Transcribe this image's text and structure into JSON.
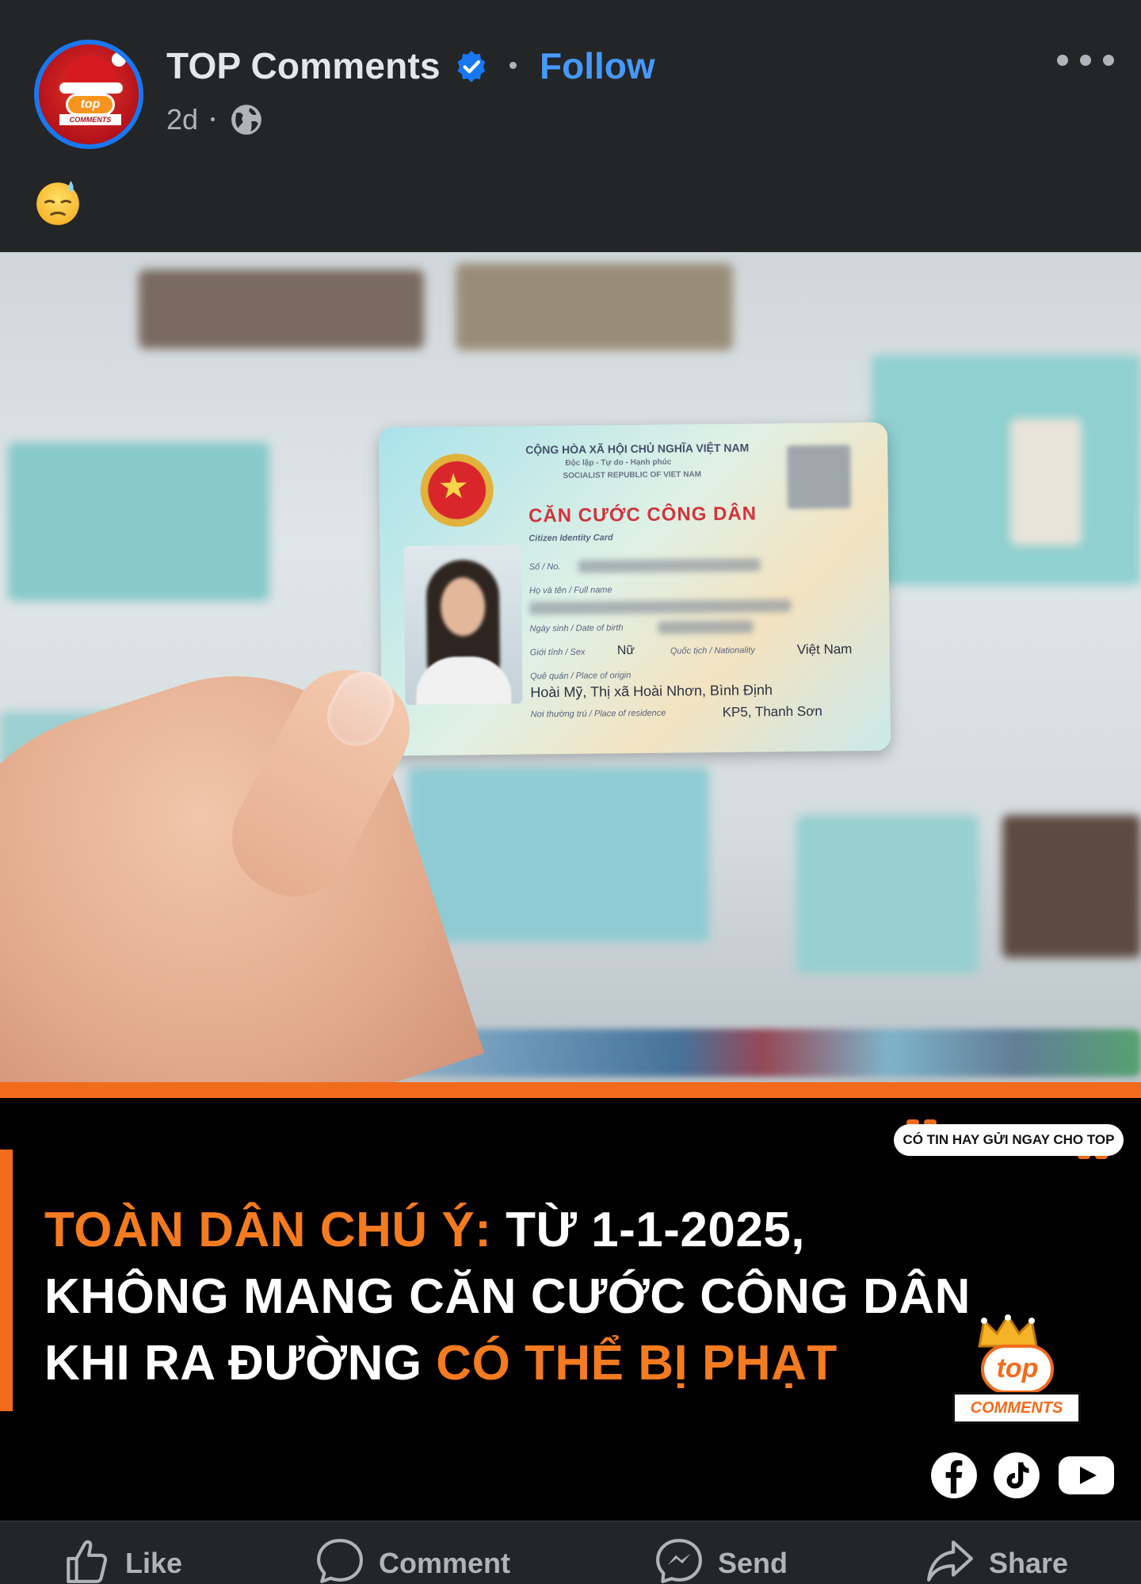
{
  "post": {
    "page_name": "TOP Comments",
    "follow_label": "Follow",
    "time": "2d",
    "emoji": "😓"
  },
  "id_card": {
    "header_line1": "CỘNG HÒA XÃ HỘI CHỦ NGHĨA VIỆT NAM",
    "header_line2": "Độc lập - Tự do - Hạnh phúc",
    "header_line3": "SOCIALIST REPUBLIC OF VIET NAM",
    "title": "CĂN CƯỚC CÔNG DÂN",
    "subtitle": "Citizen Identity Card",
    "label_no": "Số / No.",
    "label_name": "Họ và tên / Full name",
    "label_dob": "Ngày sinh / Date of birth",
    "label_sex": "Giới tính / Sex",
    "sex_value": "Nữ",
    "label_nationality": "Quốc tịch / Nationality",
    "nationality_value": "Việt Nam",
    "label_origin": "Quê quán / Place of origin",
    "origin_value": "Hoài Mỹ, Thị xã Hoài Nhơn, Bình Định",
    "label_residence": "Nơi thường trú / Place of residence",
    "residence_value": "KP5, Thanh Sơn"
  },
  "banner": {
    "tip_text": "CÓ TIN HAY GỬI NGAY CHO TOP",
    "headline_orange_1": "TOÀN DÂN CHÚ Ý:",
    "headline_white_1": " TỪ 1-1-2025,",
    "headline_white_2": "KHÔNG MANG CĂN CƯỚC CÔNG DÂN",
    "headline_white_3": "KHI RA ĐƯỜNG ",
    "headline_orange_3": "CÓ THỂ BỊ PHẠT",
    "brand_top": "top",
    "brand_comments": "COMMENTS",
    "social_icons": [
      "facebook-icon",
      "tiktok-icon",
      "youtube-icon"
    ]
  },
  "actions": {
    "like": "Like",
    "comment": "Comment",
    "send": "Send",
    "share": "Share"
  },
  "colors": {
    "background": "#242526",
    "link_blue": "#4599ff",
    "accent_orange": "#f26b1d"
  }
}
